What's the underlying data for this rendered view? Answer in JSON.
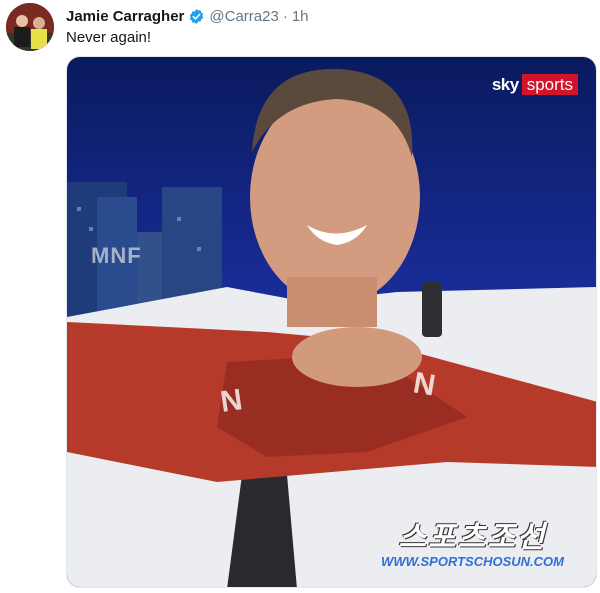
{
  "tweet": {
    "display_name": "Jamie Carragher",
    "handle": "@Carra23",
    "separator": "·",
    "time": "1h",
    "text": "Never again!",
    "verified_icon": "verified-badge-icon",
    "avatar_icon": "avatar"
  },
  "media": {
    "sky_label": "sky",
    "sports_label": "sports",
    "studio_sign": "MNF",
    "watermark_ko": "스포츠조선",
    "watermark_url": "WWW.SPORTSCHOSUN.COM",
    "sky_red": "#d2142a",
    "verified_blue": "#1da1f2"
  }
}
